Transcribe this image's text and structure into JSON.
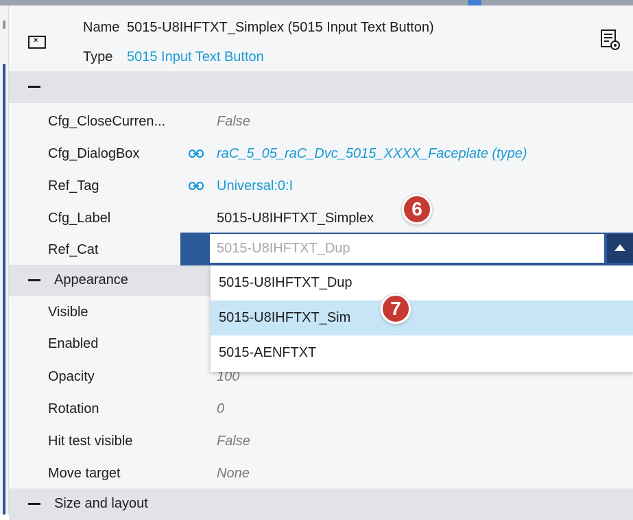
{
  "header": {
    "name_label": "Name",
    "name_value": "5015-U8IHFTXT_Simplex (5015 Input Text Button)",
    "type_label": "Type",
    "type_value": "5015 Input Text Button",
    "object_icon": "window-close-icon",
    "settings_icon": "properties-settings-icon"
  },
  "sections": {
    "main": {
      "collapse_glyph": "—",
      "title": ""
    },
    "appearance": {
      "title": "Appearance"
    },
    "size_layout": {
      "title": "Size and layout"
    }
  },
  "properties": [
    {
      "label": "Cfg_CloseCurren...",
      "value": "False",
      "style": "italic-grey",
      "linked": false
    },
    {
      "label": "Cfg_DialogBox",
      "value": "raC_5_05_raC_Dvc_5015_XXXX_Faceplate (type)",
      "style": "italic-blue",
      "linked": true
    },
    {
      "label": "Ref_Tag",
      "value": "Universal:0:I",
      "style": "blue",
      "linked": true
    },
    {
      "label": "Cfg_Label",
      "value": "5015-U8IHFTXT_Simplex",
      "style": "dark",
      "linked": false
    },
    {
      "label": "Ref_Cat",
      "value": "5015-U8IHFTXT_Dup",
      "style": "combo",
      "linked": false
    }
  ],
  "appearance_properties": [
    {
      "label": "Visible",
      "value": ""
    },
    {
      "label": "Enabled",
      "value": ""
    },
    {
      "label": "Opacity",
      "value": "100"
    },
    {
      "label": "Rotation",
      "value": "0"
    },
    {
      "label": "Hit test visible",
      "value": "False"
    },
    {
      "label": "Move target",
      "value": "None"
    }
  ],
  "ref_cat_combo": {
    "current_value": "5015-U8IHFTXT_Dup",
    "options": [
      "5015-U8IHFTXT_Dup",
      "5015-U8IHFTXT_Sim",
      "5015-AENFTXT"
    ],
    "highlighted_index": 1,
    "accent_color": "#2d5a9a",
    "highlight_color": "#c6e5f7"
  },
  "callouts": {
    "step6": "6",
    "step7": "7",
    "color": "#c63a33"
  },
  "colors": {
    "link_blue": "#1a9ad6",
    "section_bar": "#e1e3e6",
    "panel_bg": "#f5f6f7"
  }
}
